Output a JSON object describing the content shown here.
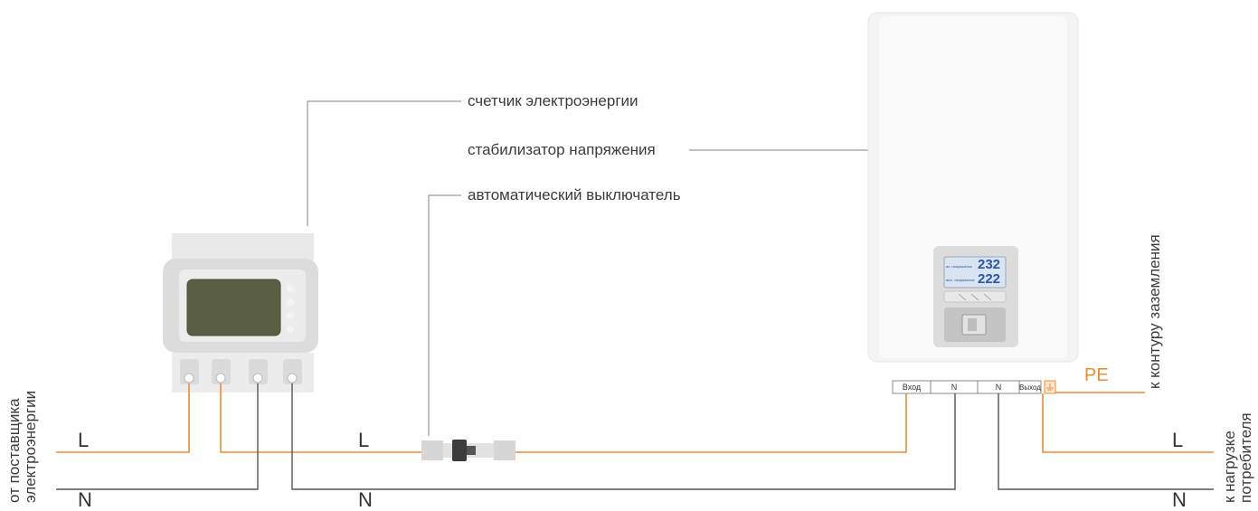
{
  "labels": {
    "meter": "счетчик электроэнергии",
    "stabilizer": "стабилизатор напряжения",
    "breaker": "автоматический выключатель",
    "ground": "к контуру заземления",
    "from_supplier": [
      "от поставщика",
      "электроэнергии"
    ],
    "to_load": [
      "к нагрузке",
      "потребителя"
    ],
    "pe": "PE"
  },
  "wires": {
    "L": "L",
    "N": "N"
  },
  "terminals": [
    "Вход",
    "N",
    "N",
    "Выход"
  ],
  "display": {
    "value_top": "232",
    "value_bottom": "222",
    "caption_top": "вх. напряжение",
    "caption_bottom": "вых. напряжение"
  },
  "colors": {
    "phase_wire": "#f08a30",
    "neutral_wire": "#555555",
    "leader_line": "#9a9a9a"
  }
}
